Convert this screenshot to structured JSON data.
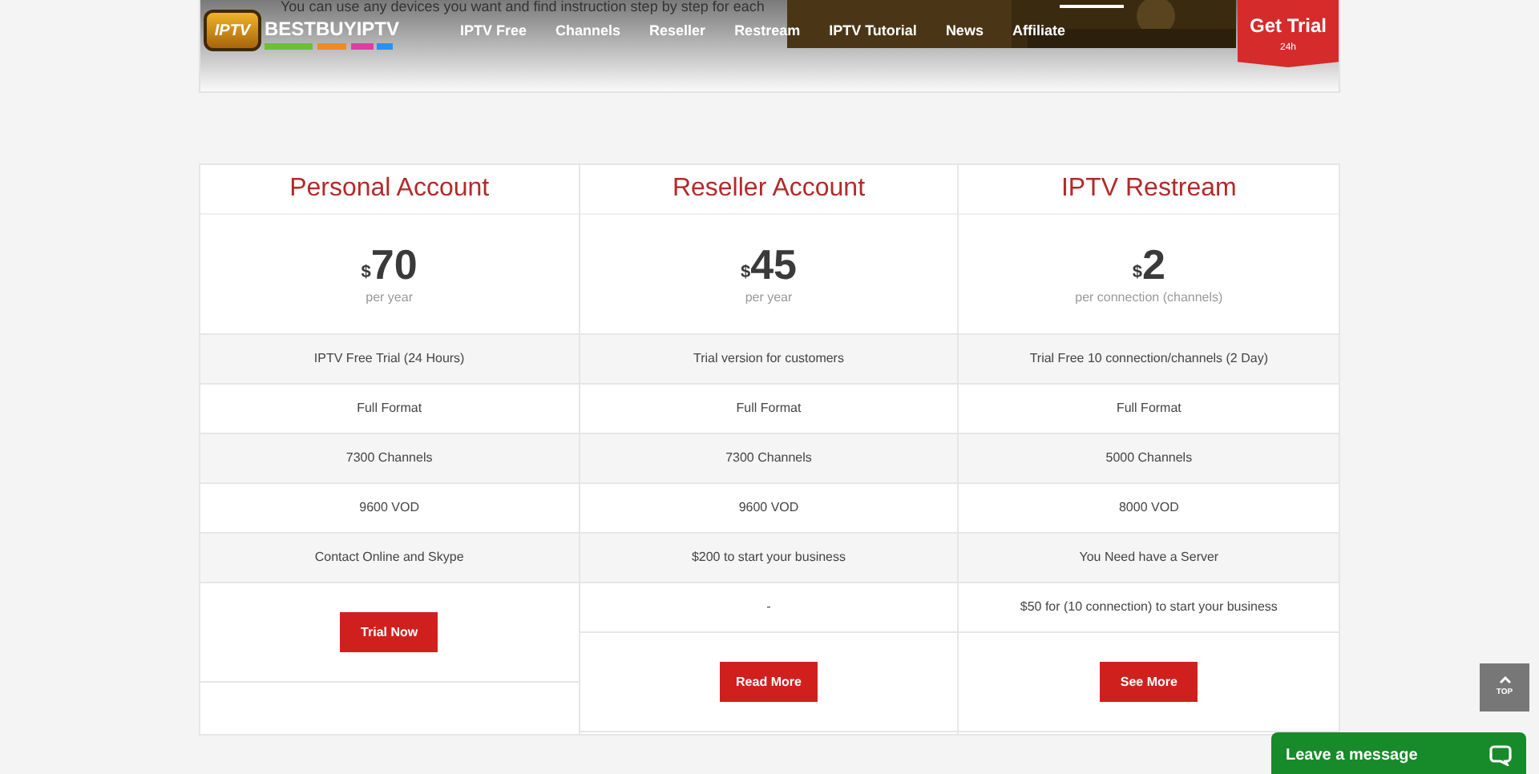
{
  "header": {
    "intro_text": "You can use any devices you want and find instruction step by step for each",
    "logo": {
      "badge": "IPTV",
      "name": "BESTBUYIPTV"
    },
    "nav": [
      {
        "label": "IPTV Free"
      },
      {
        "label": "Channels"
      },
      {
        "label": "Reseller"
      },
      {
        "label": "Restream"
      },
      {
        "label": "IPTV Tutorial"
      },
      {
        "label": "News"
      },
      {
        "label": "Affiliate"
      }
    ],
    "trial_tab": {
      "label": "Get Trial",
      "sub": "24h"
    }
  },
  "plans": [
    {
      "title": "Personal Account",
      "currency": "$",
      "price": "70",
      "period": "per year",
      "features": [
        "IPTV Free Trial (24 Hours)",
        "Full Format",
        "7300 Channels",
        "9600 VOD",
        "Contact Online and Skype"
      ],
      "button": "Trial Now"
    },
    {
      "title": "Reseller Account",
      "currency": "$",
      "price": "45",
      "period": "per year",
      "features": [
        "Trial version for customers",
        "Full Format",
        "7300 Channels",
        "9600 VOD",
        "$200 to start your business",
        "-"
      ],
      "button": "Read More"
    },
    {
      "title": "IPTV Restream",
      "currency": "$",
      "price": "2",
      "period": "per connection (channels)",
      "features": [
        "Trial Free 10 connection/channels (2 Day)",
        "Full Format",
        "5000 Channels",
        "8000 VOD",
        "You Need have a Server",
        "$50 for (10 connection) to start your business"
      ],
      "button": "See More"
    }
  ],
  "top_button": "TOP",
  "chat": {
    "label": "Leave a message"
  }
}
